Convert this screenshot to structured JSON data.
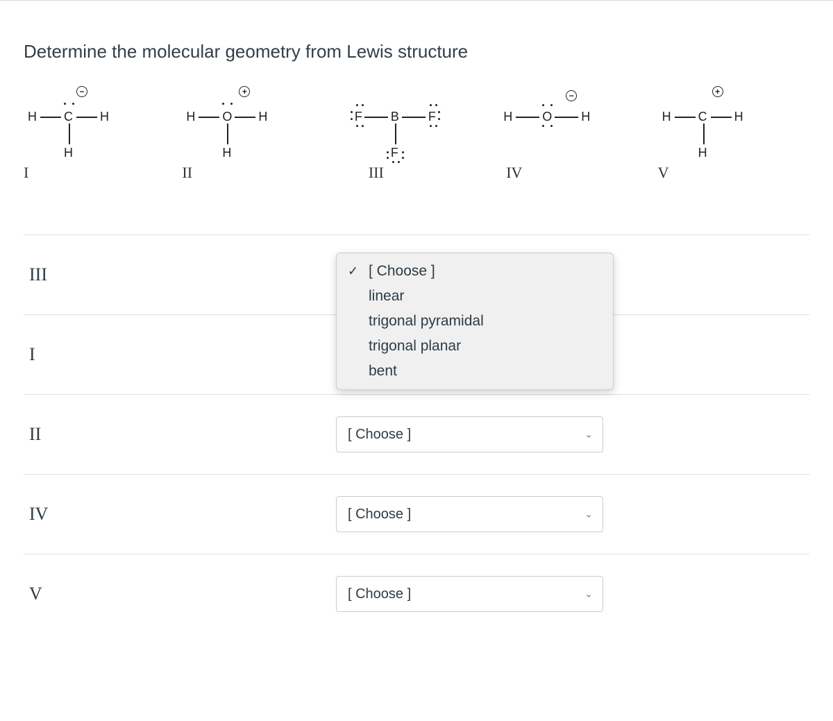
{
  "question": "Determine the molecular geometry from Lewis structure",
  "structures": [
    "I",
    "II",
    "III",
    "IV",
    "V"
  ],
  "dropdown": {
    "placeholder": "[ Choose ]",
    "options": [
      "[ Choose ]",
      "linear",
      "trigonal pyramidal",
      "trigonal planar",
      "bent"
    ]
  },
  "rows": [
    {
      "label": "III",
      "selected": "[ Choose ]",
      "open": true
    },
    {
      "label": "I",
      "selected": "[ Choose ]",
      "open": false,
      "hiddenBehind": true
    },
    {
      "label": "II",
      "selected": "[ Choose ]",
      "open": false
    },
    {
      "label": "IV",
      "selected": "[ Choose ]",
      "open": false
    },
    {
      "label": "V",
      "selected": "[ Choose ]",
      "open": false
    }
  ]
}
